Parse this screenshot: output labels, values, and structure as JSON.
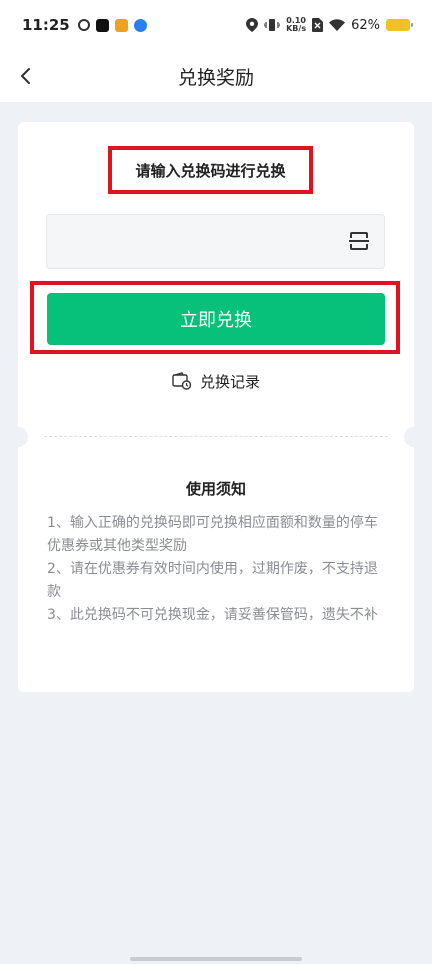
{
  "status_bar": {
    "time": "11:25",
    "net_speed_value": "0.10",
    "net_speed_unit": "KB/s",
    "battery_percent": "62%",
    "battery_color": "#f6c024"
  },
  "header": {
    "title": "兑换奖励",
    "back_icon": "chevron-left-icon"
  },
  "redeem": {
    "prompt": "请输入兑换码进行兑换",
    "code_value": "",
    "scan_icon": "scan-icon",
    "button_label": "立即兑换",
    "button_color": "#07c17a",
    "highlight_color": "#e0141e",
    "history_icon": "wallet-clock-icon",
    "history_label": "兑换记录"
  },
  "notice": {
    "title": "使用须知",
    "items": [
      "1、输入正确的兑换码即可兑换相应面额和数量的停车优惠券或其他类型奖励",
      "2、请在优惠券有效时间内使用，过期作废，不支持退款",
      "3、此兑换码不可兑换现金，请妥善保管码，遗失不补"
    ]
  }
}
